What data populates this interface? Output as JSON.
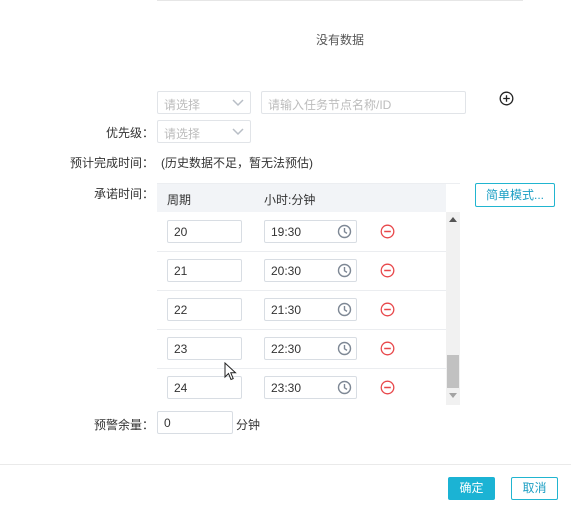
{
  "empty_state": "没有数据",
  "filter": {
    "select_placeholder": "请选择",
    "node_placeholder": "请输入任务节点名称/ID"
  },
  "priority": {
    "label": "优先级：",
    "placeholder": "请选择"
  },
  "estimate": {
    "label": "预计完成时间：",
    "value": "(历史数据不足，暂无法预估)"
  },
  "commit": {
    "label": "承诺时间：",
    "columns": [
      "周期",
      "小时:分钟"
    ],
    "rows": [
      {
        "period": "20",
        "time": "19:30"
      },
      {
        "period": "21",
        "time": "20:30"
      },
      {
        "period": "22",
        "time": "21:30"
      },
      {
        "period": "23",
        "time": "22:30"
      },
      {
        "period": "24",
        "time": "23:30"
      }
    ],
    "mode_button": "简单模式..."
  },
  "warning": {
    "label": "预警余量：",
    "value": "0",
    "unit": "分钟"
  },
  "footer": {
    "confirm": "确定",
    "cancel": "取消"
  },
  "colors": {
    "accent": "#1bb3d4",
    "danger": "#e8474a"
  }
}
